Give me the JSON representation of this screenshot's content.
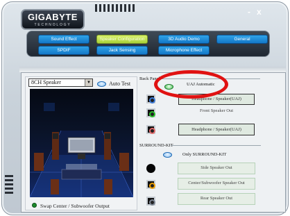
{
  "brand": {
    "name": "GIGABYTE",
    "tagline": "TECHNOLOGY"
  },
  "window": {
    "minimize": "-",
    "close": "x"
  },
  "tabs": [
    {
      "label": "Sound Effect",
      "active": false
    },
    {
      "label": "Speaker Configuration",
      "active": true
    },
    {
      "label": "3D Audio Demo",
      "active": false
    },
    {
      "label": "General",
      "active": false
    },
    {
      "label": "SPDIF",
      "active": false
    },
    {
      "label": "Jack Sensing",
      "active": false
    },
    {
      "label": "Microphone Effect",
      "active": false
    }
  ],
  "speaker_select": {
    "value": "8CH Speaker"
  },
  "auto_test": {
    "label": "Auto Test"
  },
  "swap_option": {
    "label": "Swap Center / Subwoofer Output"
  },
  "back_panel": {
    "label": "Back Panel",
    "uaj_label": "UAJ Automatic",
    "outputs": [
      {
        "label": "Headphone / Speaker(UAJ)",
        "boxed": true
      },
      {
        "label": "Front Speaker Out",
        "boxed": false
      },
      {
        "label": "Headphone / Speaker(UAJ)",
        "boxed": true
      }
    ]
  },
  "surround_kit": {
    "label": "SURROUND-KIT",
    "only_label": "Only SURROUND-KIT",
    "outputs": [
      {
        "label": "Side Speaker Out"
      },
      {
        "label": "Center/Subwoofer Speaker Out"
      },
      {
        "label": "Rear Speaker Out"
      }
    ]
  },
  "colors": {
    "accent_tab": "#1e8fd9",
    "active_tab": "#bfe04e",
    "highlight_ring": "#e01212",
    "jack_green": "#2bbf2b",
    "jack_pink": "#e56a6a",
    "jack_orange": "#f0a000"
  }
}
